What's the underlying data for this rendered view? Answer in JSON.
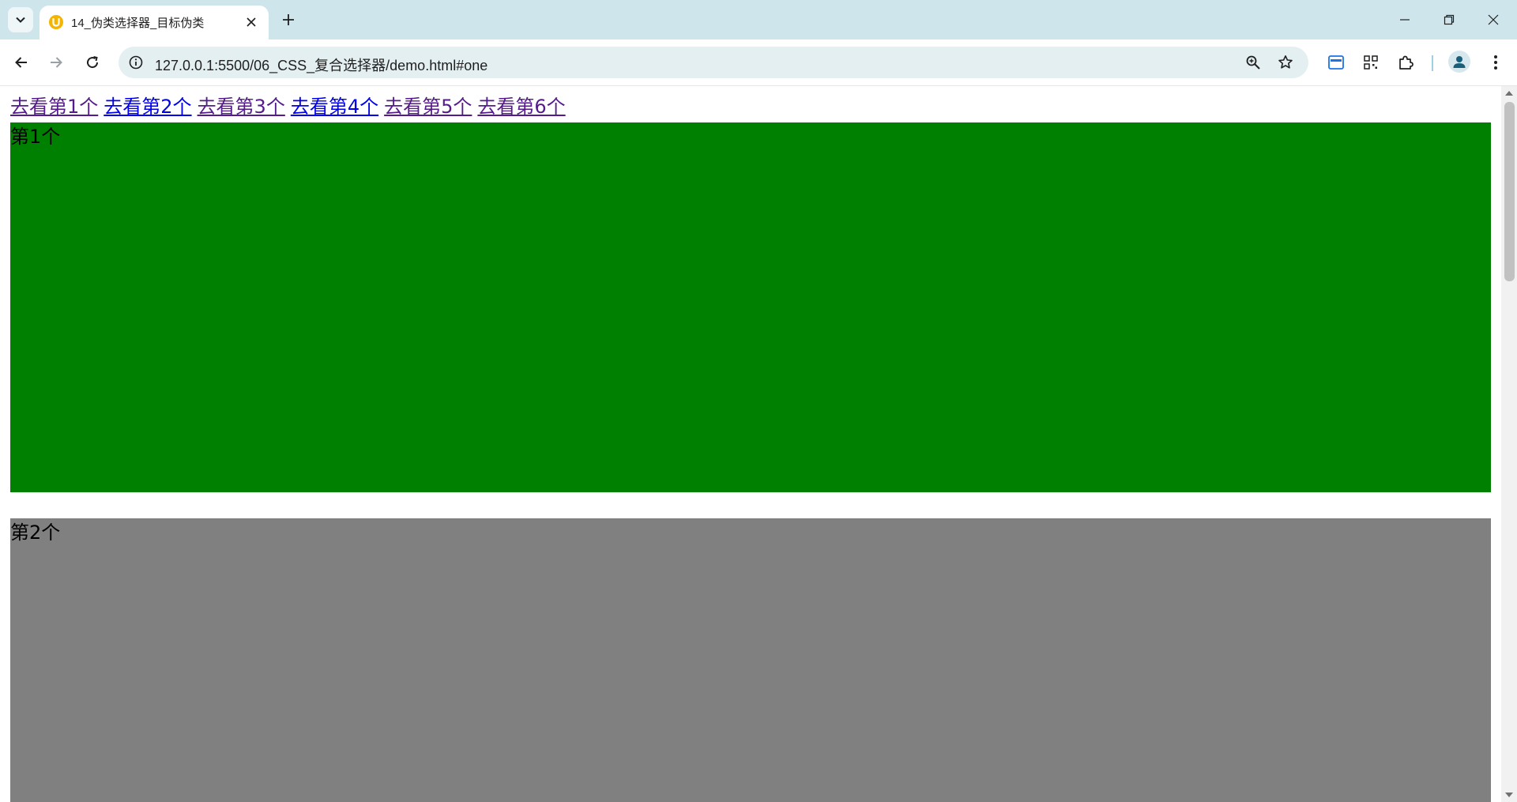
{
  "browser": {
    "tab": {
      "title": "14_伪类选择器_目标伪类",
      "favicon": "live-server-icon"
    },
    "url": "127.0.0.1:5500/06_CSS_复合选择器/demo.html#one",
    "icons": {
      "tab_search": "chevron-down-icon",
      "close_tab": "close-icon",
      "new_tab": "plus-icon",
      "minimize": "minimize-icon",
      "restore": "restore-icon",
      "close_window": "close-icon",
      "back": "arrow-left-icon",
      "forward": "arrow-right-icon",
      "reload": "reload-icon",
      "site_info": "info-icon",
      "zoom": "zoom-icon",
      "bookmark": "star-icon",
      "side_panel": "side-panel-icon",
      "qr_code": "qr-code-icon",
      "extensions": "puzzle-icon",
      "profile": "avatar-icon",
      "menu": "kebab-menu-icon"
    }
  },
  "page": {
    "links": [
      {
        "label": "去看第1个",
        "visited": true
      },
      {
        "label": "去看第2个",
        "visited": false
      },
      {
        "label": "去看第3个",
        "visited": true
      },
      {
        "label": "去看第4个",
        "visited": false
      },
      {
        "label": "去看第5个",
        "visited": true
      },
      {
        "label": "去看第6个",
        "visited": true
      }
    ],
    "sections": [
      {
        "label": "第1个",
        "color": "#008000"
      },
      {
        "label": "第2个",
        "color": "#808080"
      }
    ],
    "colors": {
      "link": "#0000ee",
      "visited_link": "#551a8b",
      "tabstrip": "#cfe5ec",
      "omnibox": "#e4eff2"
    }
  }
}
